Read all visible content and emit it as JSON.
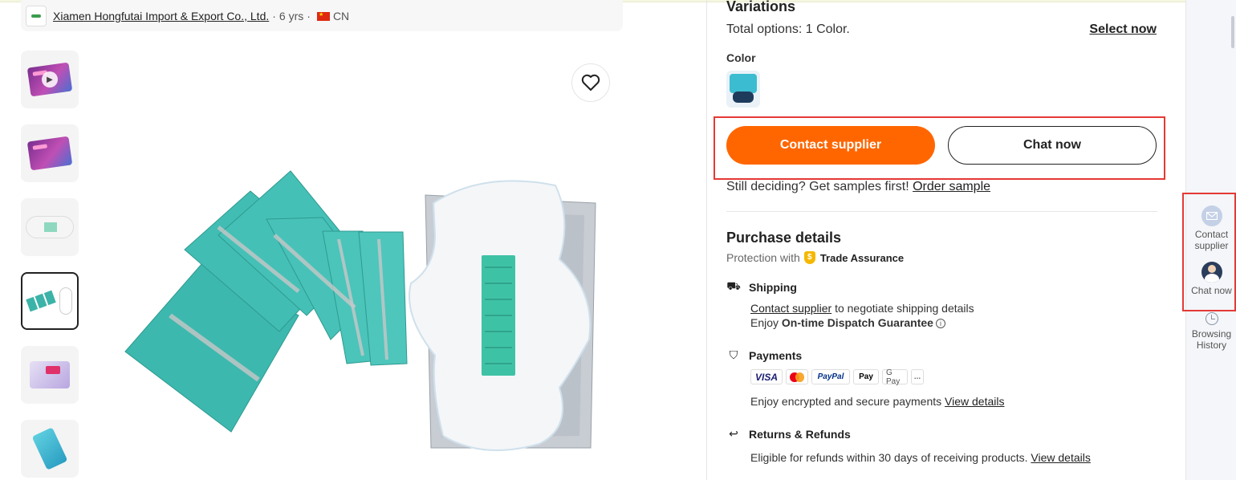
{
  "supplier": {
    "name": "Xiamen Hongfutai Import & Export Co., Ltd.",
    "years": "6 yrs",
    "country": "CN",
    "separator": "·"
  },
  "thumbnails": [
    {
      "label": "video-thumbnail",
      "icon": "play-icon"
    },
    {
      "label": "package-front"
    },
    {
      "label": "pad-closeup"
    },
    {
      "label": "packs-and-pad",
      "selected": true
    },
    {
      "label": "package-open"
    },
    {
      "label": "pouch"
    }
  ],
  "variations": {
    "title": "Variations",
    "total_prefix": "Total options:",
    "total_value": "1 Color.",
    "select_now": "Select now",
    "color_label": "Color"
  },
  "actions": {
    "contact_supplier": "Contact supplier",
    "chat_now": "Chat now",
    "samples_text": "Still deciding? Get samples first!",
    "order_sample": "Order sample"
  },
  "purchase": {
    "title": "Purchase details",
    "protection_prefix": "Protection with",
    "trade_assurance": "Trade Assurance",
    "shipping": {
      "title": "Shipping",
      "contact_link": "Contact supplier",
      "contact_rest": "to negotiate shipping details",
      "enjoy": "Enjoy",
      "guarantee": "On-time Dispatch Guarantee"
    },
    "payments": {
      "title": "Payments",
      "methods": [
        "VISA",
        "Mastercard",
        "PayPal",
        "Apple Pay",
        "G Pay",
        "..."
      ],
      "secure_text": "Enjoy encrypted and secure payments",
      "view_details": "View details"
    },
    "returns": {
      "title": "Returns & Refunds",
      "text": "Eligible for refunds within 30 days of receiving products.",
      "view_details": "View details"
    }
  },
  "sidebar": {
    "contact_supplier": "Contact supplier",
    "chat_now": "Chat now",
    "browsing_history": "Browsing History"
  },
  "colors": {
    "primary_orange": "#ff6600",
    "highlight_red": "#e53935",
    "product_teal": "#3bb3a8"
  }
}
